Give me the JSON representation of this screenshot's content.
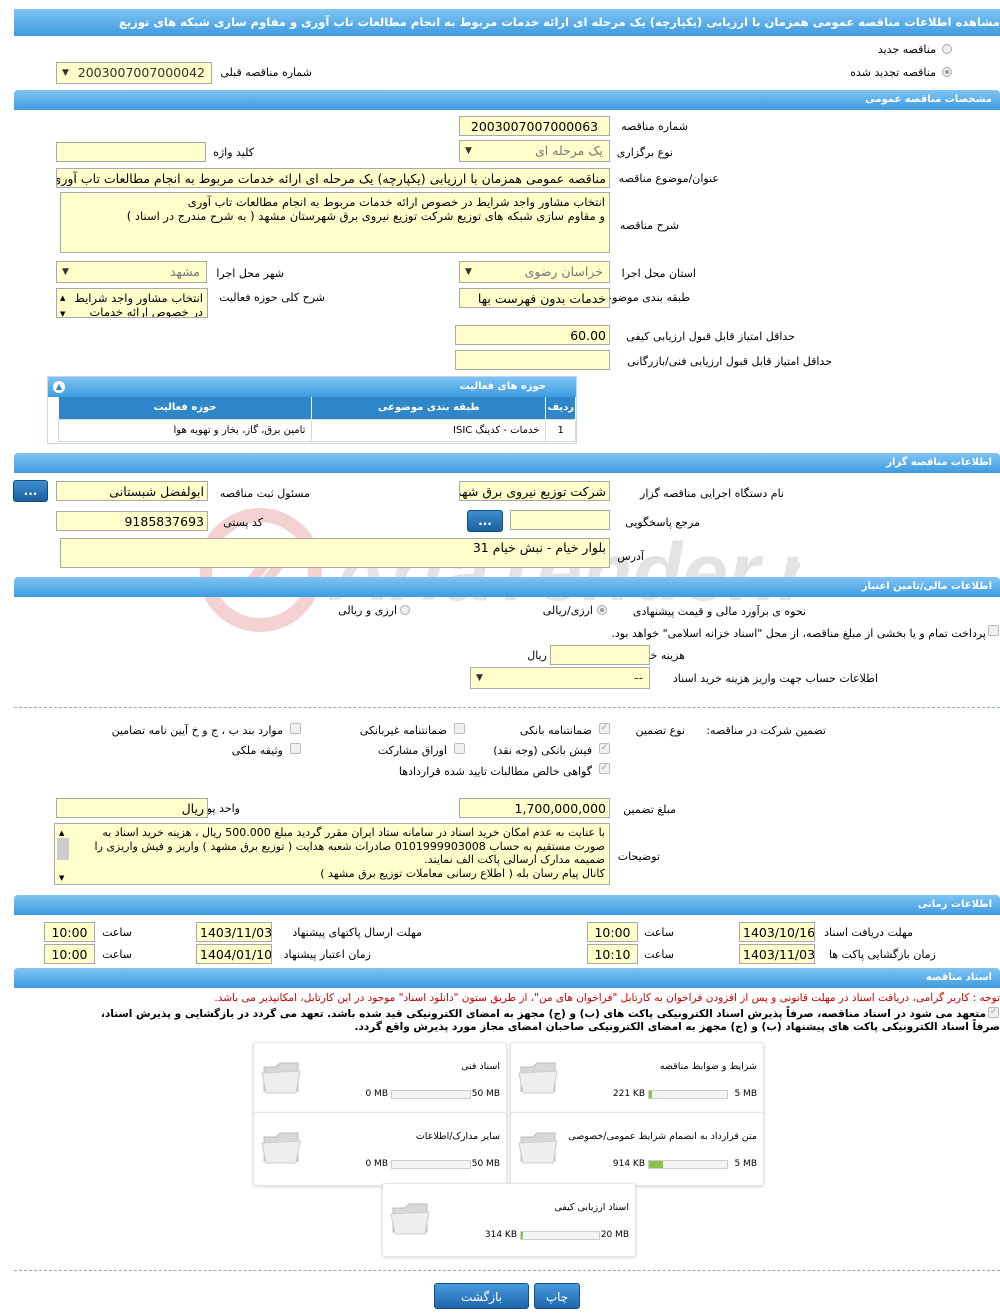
{
  "page_title": "مشاهده اطلاعات مناقصه عمومی همزمان با ارزیابی (یکپارچه) یک مرحله ای ارائه خدمات مربوط به انجام مطالعات تاب آوری و مقاوم سازی شبکه های توزیع",
  "tender_type": {
    "new_label": "مناقصه جدید",
    "renewed_label": "مناقصه تجدید شده",
    "previous_number_label": "شماره مناقصه قبلی",
    "previous_number_value": "2003007007000042"
  },
  "general": {
    "section_title": "مشخصات مناقصه عمومی",
    "number_label": "شماره مناقصه",
    "number_value": "2003007007000063",
    "holding_type_label": "نوع برگزاری",
    "holding_type_value": "یک مرحله ای",
    "keyword_label": "کلید واژه",
    "keyword_value": "",
    "subject_label": "عنوان/موضوع مناقصه",
    "subject_value": "مناقصه عمومی همزمان با ارزیابی (یکپارچه) یک مرحله ای ارائه خدمات مربوط به انجام مطالعات تاب آوری",
    "description_label": "شرح مناقصه",
    "description_lines": [
      "انتخاب مشاور واجد شرایط در خصوص ارائه خدمات مربوط به انجام مطالعات تاب آوری",
      "و مقاوم سازی شبکه های توزیع شرکت توزیع نیروی برق شهرستان مشهد  ( به شرح مندرج در اسناد )"
    ],
    "province_label": "استان محل اجرا",
    "province_value": "خراسان رضوی",
    "city_label": "شهر محل اجرا",
    "city_value": "مشهد",
    "category_label": "طبقه بندی موضوعی",
    "category_value": "خدمات بدون فهرست بها",
    "activity_desc_label": "شرح کلی حوزه فعالیت",
    "activity_desc_lines": [
      "انتخاب مشاور واجد شرایط",
      "در خصوص ارائه خدمات"
    ],
    "min_quality_label": "حداقل امتیاز قابل قبول ارزیابی کیفی",
    "min_quality_value": "60.00",
    "min_tech_label": "حداقل امتیاز قابل قبول ارزیابی فنی/بازرگانی",
    "min_tech_value": ""
  },
  "activity_table": {
    "title": "حوزه های فعالیت",
    "headers": [
      "ردیف",
      "طبقه بندی موضوعی",
      "حوزه فعالیت"
    ],
    "rows": [
      {
        "index": "1",
        "category": "خدمات - کدینگ ISIC",
        "field": "تامین برق، گاز، بخار و تهویه هوا"
      }
    ]
  },
  "organizer": {
    "section_title": "اطلاعات مناقصه گزار",
    "org_label": "نام دستگاه اجرایی مناقصه گزار",
    "org_value": "شرکت توزیع نیروی برق شهرستان مشهد",
    "registrar_label": "مسئول ثبت مناقصه",
    "registrar_value": "ابولفضل شبستانی",
    "response_ref_label": "مرجع پاسخگویی",
    "response_ref_value": "",
    "postal_label": "کد پستی",
    "postal_value": "9185837693",
    "address_label": "آدرس",
    "address_value": "بلوار خیام - نبش خیام 31",
    "dots_label": "..."
  },
  "finance": {
    "section_title": "اطلاعات مالی/تامین اعتبار",
    "estimate_label": "نحوه ی برآورد مالی و قیمت پیشنهادی",
    "opt_currency": "ارزی/ریالی",
    "opt_currency_rial": "ارزی و ریالی",
    "treasury_text": "پرداخت تمام و یا بخشی از مبلغ مناقصه، از محل \"اسناد خزانه اسلامی\" خواهد بود.",
    "doc_cost_label": "هزینه خرید اسناد",
    "doc_cost_value": "",
    "doc_cost_unit": "ریال",
    "account_label": "اطلاعات حساب جهت واریز هزینه خرید اسناد",
    "account_value": "--"
  },
  "guarantee": {
    "participation_label": "تضمین شرکت در مناقصه:",
    "type_label": "نوع تضمین",
    "options": [
      {
        "label": "ضمانتنامه بانکی",
        "checked": true
      },
      {
        "label": "ضمانتنامه غیربانکی",
        "checked": false
      },
      {
        "label": "موارد بند ب ، ج و خ آیین نامه تضامین",
        "checked": false
      },
      {
        "label": "فیش بانکی (وجه نقد)",
        "checked": true
      },
      {
        "label": "اوراق مشارکت",
        "checked": false
      },
      {
        "label": "وثیقه ملکی",
        "checked": false
      },
      {
        "label": "گواهی خالص مطالبات تایید شده قراردادها",
        "checked": true
      }
    ],
    "amount_label": "مبلغ تضمین",
    "amount_value": "1,700,000,000",
    "currency_label": "واحد پول",
    "currency_value": "ریال",
    "notes_label": "توضیحات",
    "notes_lines": [
      "با عنایت به عدم امکان خرید اسناد در سامانه ستاد ایران مقرر گردید مبلغ 500.000 ریال ، هزینه خرید اسناد به",
      "صورت مستقیم به حساب 0101999903008  صادرات شعبه هدایت ( توزیع برق مشهد ) واریز و فیش واریزی را",
      "ضمیمه مدارک ارسالی پاکت الف نمایند.",
      "کانال  پیام رسان بله ( اطلاع رسانی معاملات توزیع برق مشهد )"
    ]
  },
  "timing": {
    "section_title": "اطلاعات زمانی",
    "receive_docs_label": "مهلت دریافت اسناد",
    "receive_docs_date": "1403/10/16",
    "receive_docs_time": "10:00",
    "send_deadline_label": "مهلت ارسال پاکتهای پیشنهاد",
    "send_deadline_date": "1403/11/03",
    "send_deadline_time": "10:00",
    "open_label": "زمان بازگشایی پاکت ها",
    "open_date": "1403/11/03",
    "open_time": "10:10",
    "validity_label": "زمان اعتبار پیشنهاد",
    "validity_date": "1404/01/10",
    "validity_time": "10:00",
    "time_label": "ساعت"
  },
  "documents": {
    "section_title": "اسناد مناقصه",
    "notice": "توجه : کاربر گرامی، دریافت اسناد در مهلت قانونی و پس از افزودن فراخوان به کارتابل \"فراخوان های من\"، از طریق ستون \"دانلود اسناد\" موجود در این کارتابل، امکانپذیر می باشد.",
    "commit_line1": "متعهد می شود در اسناد مناقصه، صرفاً پذیرش اسناد الکترونیکی پاکت های (ب) و (ج) مجهز به امضای الکترونیکی قید شده باشد. تعهد می گردد در بازگشایی و پذیرش اسناد،",
    "commit_line2": "صرفاً اسناد الکترونیکی پاکت های پیشنهاد (ب) و (ج) مجهز به امضای الکترونیکی صاحبان امضای مجاز مورد پذیرش واقع گردد.",
    "cards": [
      {
        "title": "شرایط و ضوابط مناقصه",
        "current": "221 KB",
        "max": "5 MB",
        "fill": 0.04
      },
      {
        "title": "اسناد فنی",
        "current": "0 MB",
        "max": "50 MB",
        "fill": 0
      },
      {
        "title": "متن قرارداد به انضمام شرایط عمومی/خصوصی",
        "current": "914 KB",
        "max": "5 MB",
        "fill": 0.18
      },
      {
        "title": "سایر مدارک/اطلاعات",
        "current": "0 MB",
        "max": "50 MB",
        "fill": 0
      },
      {
        "title": "اسناد ارزیابی کیفی",
        "current": "314 KB",
        "max": "20 MB",
        "fill": 0.02
      }
    ]
  },
  "buttons": {
    "print": "چاپ",
    "back": "بازگشت"
  },
  "watermark_text": "AriaTender.neT",
  "colors": {
    "section_bar": "#3d9be0",
    "field_bg": "#ffffcc",
    "notice_red": "#cc0000",
    "progress_fill": "#8bc34a"
  }
}
